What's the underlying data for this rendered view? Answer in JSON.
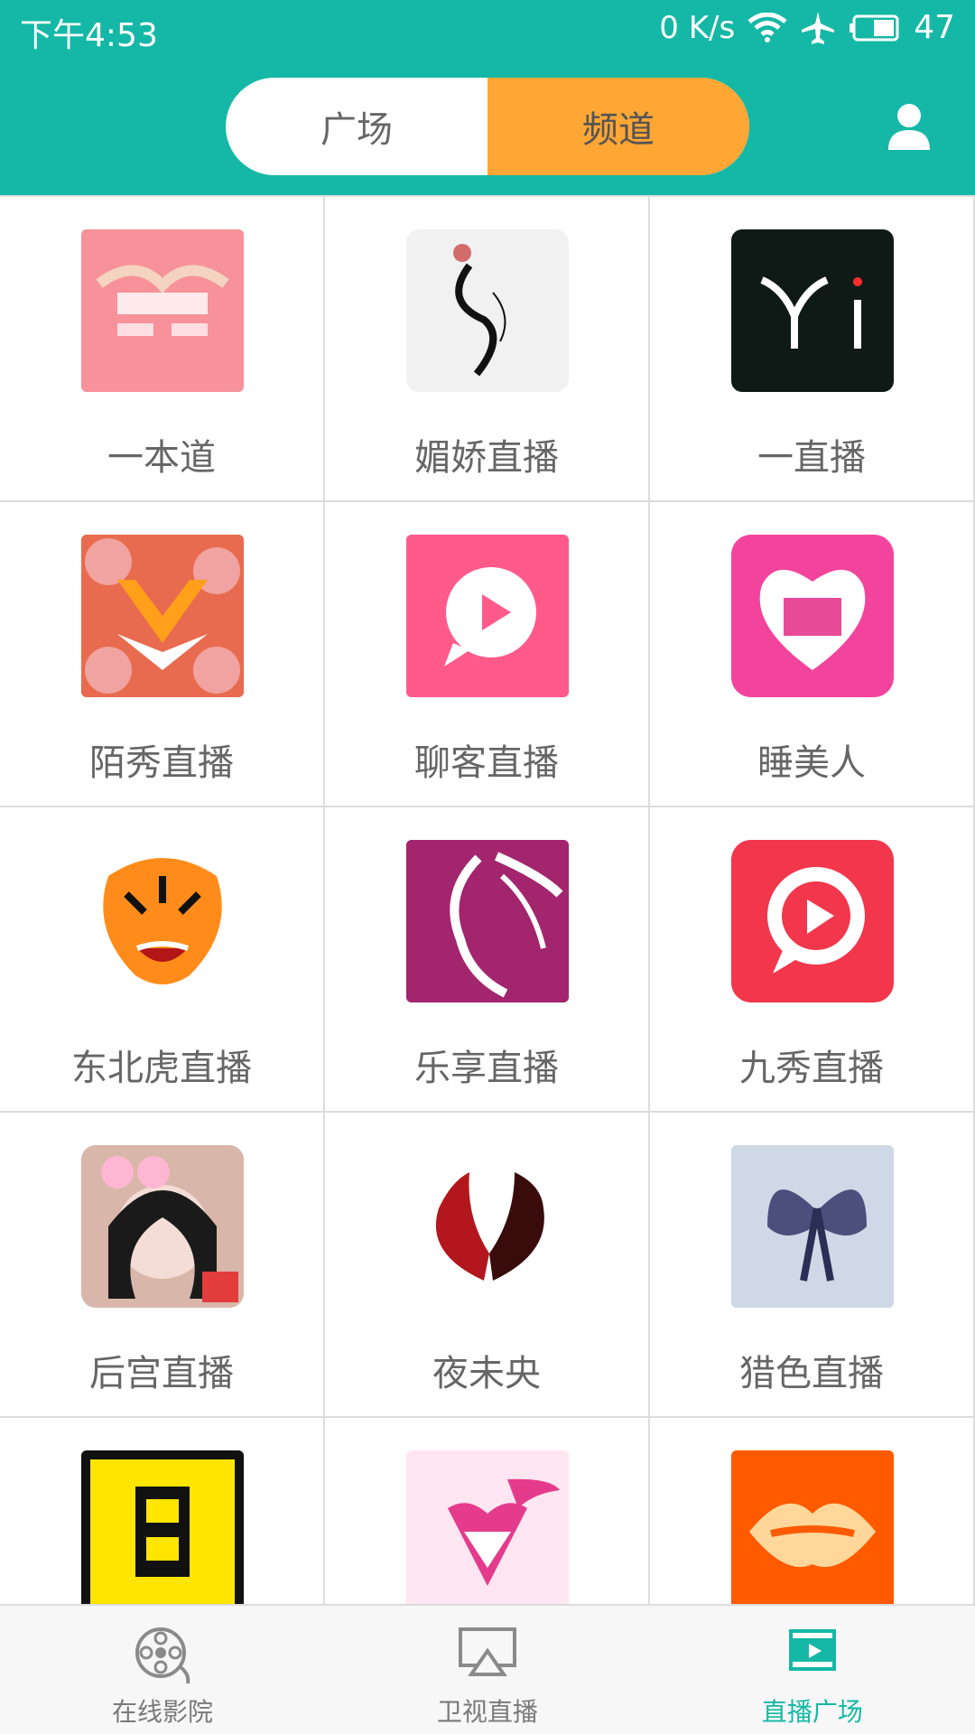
{
  "status": {
    "time": "下午4:53",
    "net": "0 K/s",
    "battery": "47"
  },
  "top_tabs": [
    {
      "label": "广场"
    },
    {
      "label": "频道"
    }
  ],
  "channels": [
    {
      "name": "一本道",
      "icon": "yibendao-logo",
      "color": "#f7919a"
    },
    {
      "name": "媚娇直播",
      "icon": "meijiao-logo",
      "color": "#f5f5f5"
    },
    {
      "name": "一直播",
      "icon": "yi-logo",
      "color": "#0f1a16"
    },
    {
      "name": "陌秀直播",
      "icon": "moxiu-logo",
      "color": "#e86b4f"
    },
    {
      "name": "聊客直播",
      "icon": "liaoke-logo",
      "color": "#ff5a8a"
    },
    {
      "name": "睡美人",
      "icon": "shuimeiren-logo",
      "color": "#f2449c"
    },
    {
      "name": "东北虎直播",
      "icon": "tiger-logo",
      "color": "#ffffff"
    },
    {
      "name": "乐享直播",
      "icon": "lexiang-logo",
      "color": "#a3256e"
    },
    {
      "name": "九秀直播",
      "icon": "jiuxiu-logo",
      "color": "#f2364c"
    },
    {
      "name": "后宫直播",
      "icon": "hougong-logo",
      "color": "#d8b6a9"
    },
    {
      "name": "夜未央",
      "icon": "yeweiyang-logo",
      "color": "#ffffff"
    },
    {
      "name": "猎色直播",
      "icon": "liese-logo",
      "color": "#cfd8e6"
    },
    {
      "name": "",
      "icon": "yellow-logo",
      "color": "#ffe500"
    },
    {
      "name": "",
      "icon": "fox-logo",
      "color": "#ffe6f0"
    },
    {
      "name": "",
      "icon": "lips-logo",
      "color": "#ff5a00"
    }
  ],
  "bottom_nav": [
    {
      "label": "在线影院",
      "icon": "film-reel-icon"
    },
    {
      "label": "卫视直播",
      "icon": "tv-cast-icon"
    },
    {
      "label": "直播广场",
      "icon": "video-play-icon"
    }
  ],
  "colors": {
    "header": "#15b8a6",
    "active_tab": "#ffa635",
    "accent": "#15b8a6"
  }
}
